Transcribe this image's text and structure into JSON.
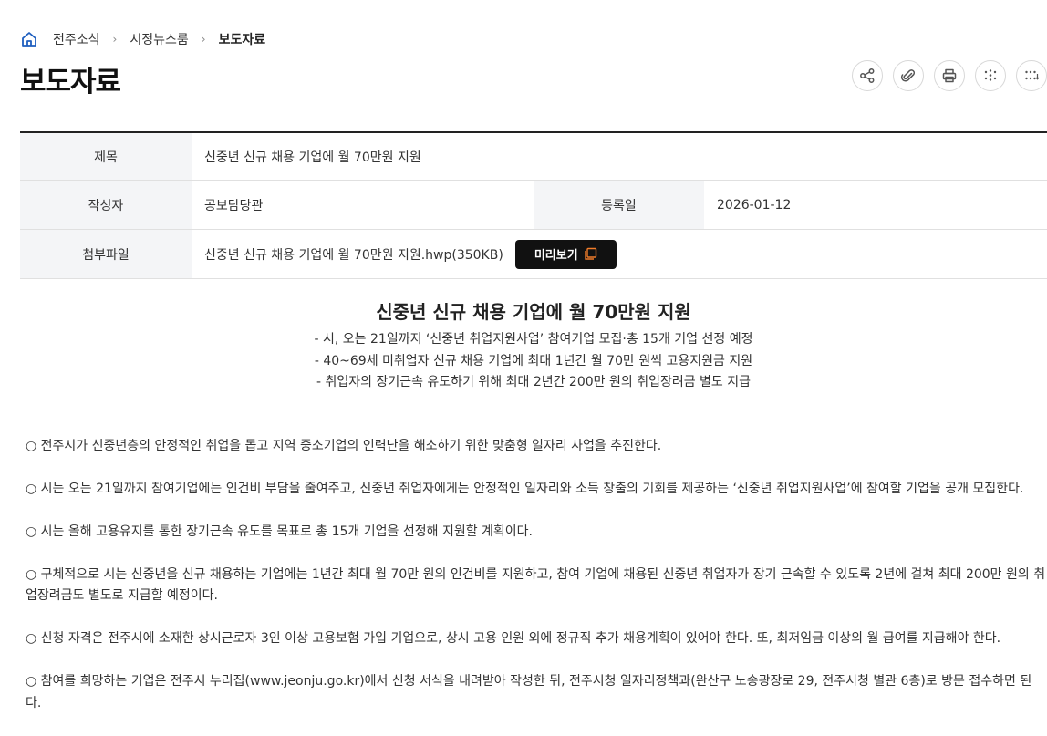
{
  "breadcrumb": {
    "items": [
      "전주소식",
      "시정뉴스룸"
    ],
    "current": "보도자료",
    "separator": "›"
  },
  "page": {
    "title": "보도자료"
  },
  "tools": [
    "share-icon",
    "attachment-icon",
    "print-icon",
    "expand-icon",
    "collapse-icon"
  ],
  "info": {
    "title_label": "제목",
    "title_value": "신중년 신규 채용 기업에 월 70만원 지원",
    "author_label": "작성자",
    "author_value": "공보담당관",
    "date_label": "등록일",
    "date_value": "2026-01-12",
    "file_label": "첨부파일",
    "file_value": "신중년 신규 채용 기업에 월 70만원 지원.hwp(350KB)",
    "preview_label": "미리보기"
  },
  "article": {
    "title": "신중년 신규 채용 기업에 월 70만원 지원",
    "summary": [
      "- 시, 오는 21일까지 ‘신중년 취업지원사업’ 참여기업 모집·총 15개 기업 선정 예정",
      "- 40~69세 미취업자 신규 채용 기업에 최대 1년간 월 70만 원씩 고용지원금 지원",
      "- 취업자의 장기근속 유도하기 위해 최대 2년간 200만 원의 취업장려금 별도 지급"
    ],
    "paragraphs": [
      "○ 전주시가 신중년층의 안정적인 취업을 돕고 지역 중소기업의 인력난을 해소하기 위한 맞춤형 일자리 사업을 추진한다.",
      "○ 시는 오는 21일까지 참여기업에는 인건비 부담을 줄여주고, 신중년 취업자에게는 안정적인 일자리와 소득 창출의 기회를 제공하는 ‘신중년 취업지원사업’에 참여할 기업을 공개 모집한다.",
      "○ 시는 올해 고용유지를 통한 장기근속 유도를 목표로 총 15개 기업을 선정해 지원할 계획이다.",
      "○ 구체적으로 시는 신중년을 신규 채용하는 기업에는 1년간 최대 월 70만 원의 인건비를 지원하고, 참여 기업에 채용된 신중년 취업자가 장기 근속할 수 있도록 2년에 걸쳐 최대 200만 원의 취업장려금도 별도로 지급할 예정이다.",
      "○ 신청 자격은 전주시에 소재한 상시근로자 3인 이상 고용보험 가입 기업으로, 상시 고용 인원 외에 정규직 추가 채용계획이 있어야 한다. 또, 최저임금 이상의 월 급여를 지급해야 한다.",
      "○ 참여를 희망하는 기업은 전주시 누리집(www.jeonju.go.kr)에서 신청 서식을 내려받아 작성한 뒤, 전주시청 일자리정책과(완산구 노송광장로 29, 전주시청 별관 6층)로 방문 접수하면 된다."
    ]
  },
  "colors": {
    "header_bg": "#f4f5f7",
    "preview_bg": "#111111",
    "preview_icon": "#f07c2a",
    "home_icon": "#1f5fbf"
  }
}
